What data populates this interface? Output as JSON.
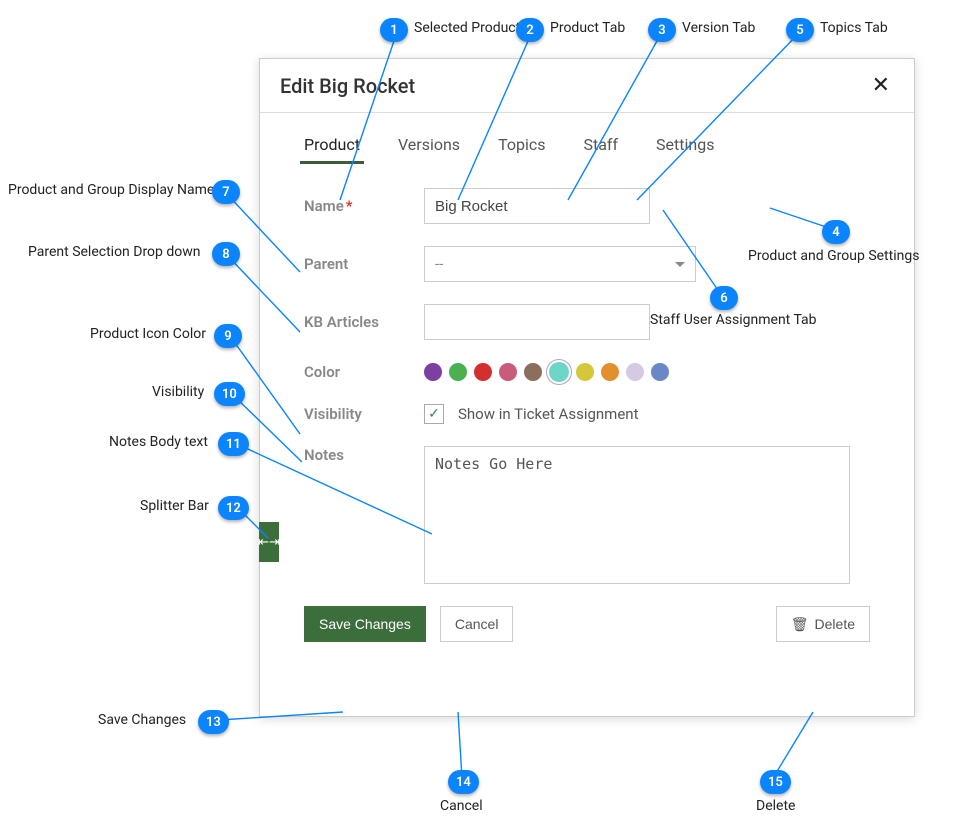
{
  "dialog": {
    "title": "Edit Big Rocket"
  },
  "tabs": {
    "product": "Product",
    "versions": "Versions",
    "topics": "Topics",
    "staff": "Staff",
    "settings": "Settings"
  },
  "form": {
    "name_label": "Name",
    "name_required": "*",
    "name_value": "Big Rocket",
    "parent_label": "Parent",
    "parent_value": "--",
    "kb_label": "KB Articles",
    "kb_value": "",
    "color_label": "Color",
    "visibility_label": "Visibility",
    "visibility_text": "Show in Ticket Assignment",
    "visibility_checked": true,
    "notes_label": "Notes",
    "notes_value": "Notes Go Here"
  },
  "colors": {
    "options": [
      "#7e3fa3",
      "#4caf50",
      "#d32f2f",
      "#c95b7b",
      "#8b6f5c",
      "#6ed6c8",
      "#d3c83a",
      "#e2902e",
      "#d6c9e6",
      "#6b87c7"
    ],
    "selected_index": 5
  },
  "actions": {
    "save": "Save Changes",
    "cancel": "Cancel",
    "delete": "Delete"
  },
  "callouts": {
    "c1": {
      "n": "1",
      "label": "Selected Product"
    },
    "c2": {
      "n": "2",
      "label": "Product Tab"
    },
    "c3": {
      "n": "3",
      "label": "Version Tab"
    },
    "c4": {
      "n": "4",
      "label": "Product and Group Settings"
    },
    "c5": {
      "n": "5",
      "label": "Topics Tab"
    },
    "c6": {
      "n": "6",
      "label": "Staff User Assignment Tab"
    },
    "c7": {
      "n": "7",
      "label": "Product and Group Display Name"
    },
    "c8": {
      "n": "8",
      "label": "Parent Selection Drop down"
    },
    "c9": {
      "n": "9",
      "label": "Product Icon Color"
    },
    "c10": {
      "n": "10",
      "label": "Visibility"
    },
    "c11": {
      "n": "11",
      "label": "Notes Body text"
    },
    "c12": {
      "n": "12",
      "label": "Splitter Bar"
    },
    "c13": {
      "n": "13",
      "label": "Save Changes"
    },
    "c14": {
      "n": "14",
      "label": "Cancel"
    },
    "c15": {
      "n": "15",
      "label": "Delete"
    }
  }
}
